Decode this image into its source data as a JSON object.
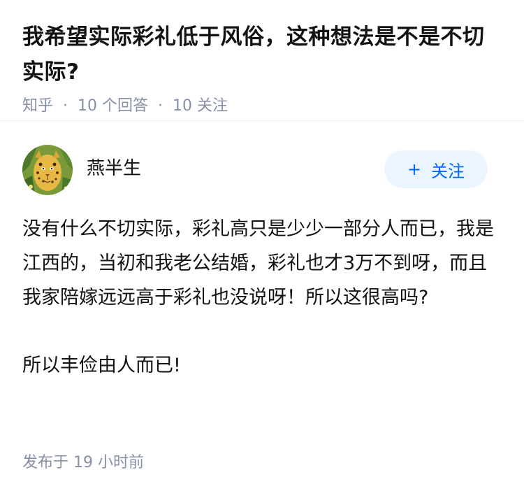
{
  "question": {
    "title": "我希望实际彩礼低于风俗，这种想法是不是不切实际?",
    "source": "知乎",
    "answers_count": "10 个回答",
    "followers_count": "10 关注"
  },
  "answer": {
    "author": {
      "name": "燕半生",
      "avatar_icon": "leopard-avatar-icon"
    },
    "follow_button": {
      "icon": "plus-icon",
      "label": "关注"
    },
    "paragraphs": [
      "没有什么不切实际，彩礼高只是少少一部分人而已，我是江西的，当初和我老公结婚，彩礼也才3万不到呀，而且我家陪嫁远远高于彩礼也没说呀！所以这很高吗?",
      "所以丰俭由人而已!"
    ],
    "published": "发布于  19 小时前"
  },
  "colors": {
    "text": "#121212",
    "meta": "#8590a6",
    "accent": "#0066ff",
    "follow_bg": "#ebf5ff"
  }
}
